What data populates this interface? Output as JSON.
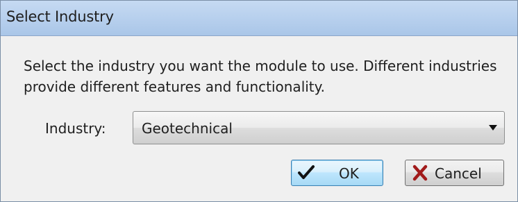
{
  "window": {
    "title": "Select Industry"
  },
  "description": "Select the industry you want the module to use. Different industries provide different features and functionality.",
  "industry": {
    "label": "Industry:",
    "selected": "Geotechnical"
  },
  "buttons": {
    "ok_label": "OK",
    "cancel_label": "Cancel",
    "ok_icon": "checkmark-icon",
    "cancel_icon": "x-icon"
  },
  "colors": {
    "titlebar": "#b9d1ee",
    "dialog_bg": "#f0f0f0",
    "ok_focus_border": "#3c7fb1",
    "cancel_x": "#a11a1a"
  }
}
